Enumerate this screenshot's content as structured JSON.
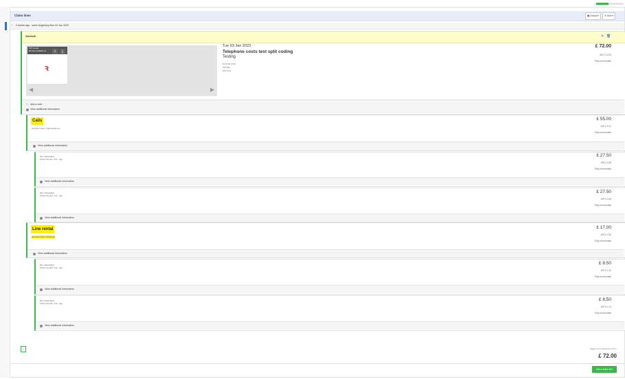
{
  "header": {
    "title": "Claim lines",
    "group_btn": "Group",
    "sort_btn": "Sort"
  },
  "group_bar": {
    "label": "0 weeks ago - week beginning Mon 02 Jan 2023"
  },
  "progress": {
    "fraction": 0.45
  },
  "expense": {
    "tag": "Abertoth",
    "receipt_title": "VAT receipt",
    "receipt_sub": "Receipt available as",
    "date": "Tue 03 Jan 2023",
    "title": "Telephone costs test split coding",
    "description": "Testing",
    "meta": [
      "Nominal Code:",
      "ISO flag",
      "ISO Type"
    ],
    "amount": "£ 72.00",
    "vat": "VAT £ 12.00",
    "recoverable": "Fully recoverable",
    "add_note": "Add a note",
    "view_info": "View additional information"
  },
  "splits": [
    {
      "name": "Calls",
      "sub": "Nominal Code: Calls telephone",
      "amount": "£ 55.00",
      "vat": "VAT £ 9.17",
      "recoverable": "Fully recoverable",
      "view_info": "View additional information",
      "children": [
        {
          "line1": "Ref: 4ZhosbEQ",
          "line2": "Order Number: 111 - ago",
          "amount": "£ 27.50",
          "vat": "VAT £ 4.58",
          "recoverable": "Fully recoverable",
          "view_info": "View additional information"
        },
        {
          "line1": "Ref: 4ZhosbEQ",
          "line2": "Order Number: 111 - ago",
          "amount": "£ 27.50",
          "vat": "VAT £ 4.59",
          "recoverable": "Fully recoverable",
          "view_info": "View additional information"
        }
      ]
    },
    {
      "name": "Line rental",
      "sub": "Nominal Code: Telephone",
      "amount": "£ 17.00",
      "vat": "VAT £ 2.83",
      "recoverable": "Fully recoverable",
      "view_info": "View additional information",
      "children": [
        {
          "line1": "Ref: 4ZhosbEQ",
          "line2": "Order Number: 111 - ago",
          "amount": "£ 8.50",
          "vat": "VAT £ 1.42",
          "recoverable": "Fully recoverable",
          "view_info": "View additional information"
        },
        {
          "line1": "Ref: 4ZhosbEQ",
          "line2": "Order Number: 111 - ago",
          "amount": "£ 8.50",
          "vat": "VAT £ 1.41",
          "recoverable": "Fully recoverable",
          "view_info": "View additional information"
        }
      ]
    }
  ],
  "footer": {
    "page": "1",
    "page_info": "Page 1 of 1, Items 1 to 7 of 7",
    "total": "£ 72.00",
    "add_btn": "Add a claim line"
  }
}
